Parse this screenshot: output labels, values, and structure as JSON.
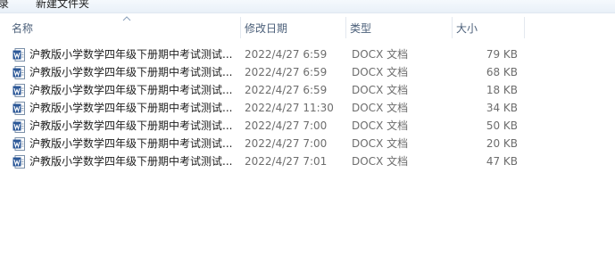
{
  "toolbar": {
    "item1": "录",
    "item2": "新建文件夹"
  },
  "columns": {
    "name": "名称",
    "date": "修改日期",
    "type": "类型",
    "size": "大小"
  },
  "icons": {
    "file": "word-docx-icon",
    "sort": "sort-ascending-icon"
  },
  "colors": {
    "word_blue": "#2b5797",
    "header_text": "#4c607a",
    "meta_text": "#6d6d6d"
  },
  "files": [
    {
      "name": "沪教版小学数学四年级下册期中考试测试...",
      "date": "2022/4/27 6:59",
      "type": "DOCX 文档",
      "size": "79 KB"
    },
    {
      "name": "沪教版小学数学四年级下册期中考试测试...",
      "date": "2022/4/27 6:59",
      "type": "DOCX 文档",
      "size": "68 KB"
    },
    {
      "name": "沪教版小学数学四年级下册期中考试测试...",
      "date": "2022/4/27 6:59",
      "type": "DOCX 文档",
      "size": "18 KB"
    },
    {
      "name": "沪教版小学数学四年级下册期中考试测试...",
      "date": "2022/4/27 11:30",
      "type": "DOCX 文档",
      "size": "34 KB"
    },
    {
      "name": "沪教版小学数学四年级下册期中考试测试...",
      "date": "2022/4/27 7:00",
      "type": "DOCX 文档",
      "size": "50 KB"
    },
    {
      "name": "沪教版小学数学四年级下册期中考试测试...",
      "date": "2022/4/27 7:00",
      "type": "DOCX 文档",
      "size": "20 KB"
    },
    {
      "name": "沪教版小学数学四年级下册期中考试测试...",
      "date": "2022/4/27 7:01",
      "type": "DOCX 文档",
      "size": "47 KB"
    }
  ]
}
